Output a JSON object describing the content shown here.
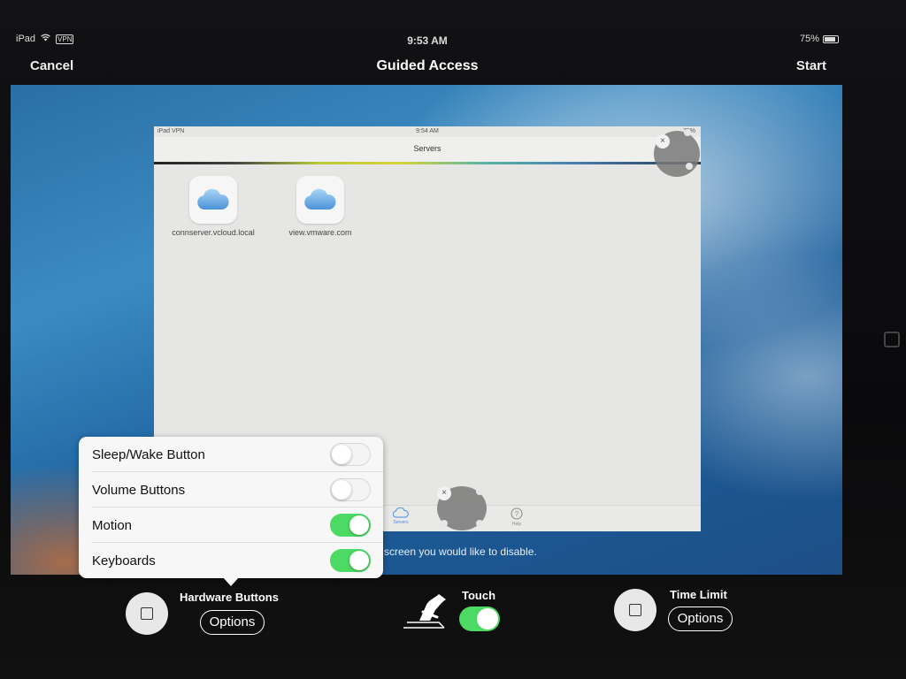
{
  "status_bar": {
    "device": "iPad",
    "vpn": "VPN",
    "time": "9:53 AM",
    "battery": "75%"
  },
  "nav": {
    "cancel": "Cancel",
    "title": "Guided Access",
    "start": "Start"
  },
  "inner_app": {
    "status_device": "iPad",
    "status_vpn": "VPN",
    "time": "9:54 AM",
    "battery": "75%",
    "title": "Servers",
    "servers": [
      {
        "name": "connserver.vcloud.local"
      },
      {
        "name": "view.vmware.com"
      }
    ],
    "tabs": [
      {
        "label": "Servers",
        "icon": "cloud-icon"
      },
      {
        "label": "Help",
        "icon": "help-icon"
      }
    ]
  },
  "hint_text": "e screen you would like to disable.",
  "popover": {
    "rows": [
      {
        "label": "Sleep/Wake Button",
        "on": false
      },
      {
        "label": "Volume Buttons",
        "on": false
      },
      {
        "label": "Motion",
        "on": true
      },
      {
        "label": "Keyboards",
        "on": true
      }
    ]
  },
  "controls": {
    "hardware_buttons": {
      "label": "Hardware Buttons",
      "options": "Options"
    },
    "touch": {
      "label": "Touch",
      "on": true
    },
    "time_limit": {
      "label": "Time Limit",
      "options": "Options"
    }
  },
  "colors": {
    "toggle_on": "#4cd964",
    "accent_blue": "#4a8de2"
  }
}
